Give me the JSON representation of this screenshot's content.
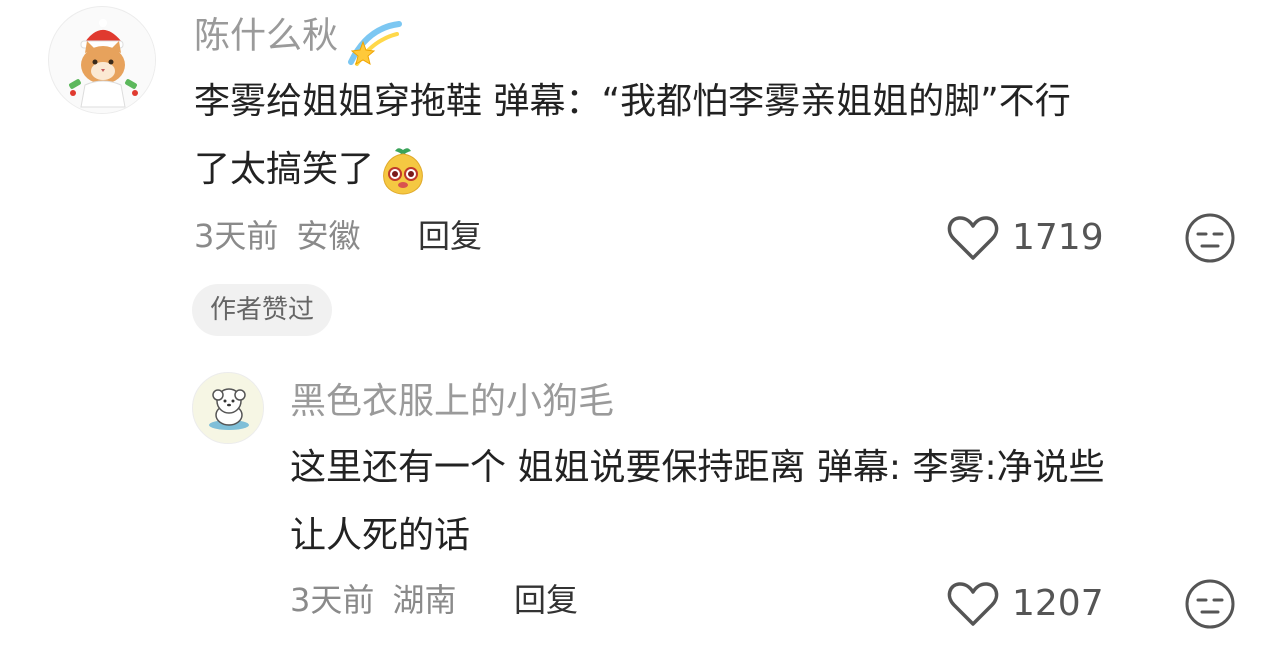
{
  "comments": [
    {
      "username": "陈什么秋",
      "text_line1": "李雾给姐姐穿拖鞋 弹幕：“我都怕李雾亲姐姐的脚”不行",
      "text_line2": "了太搞笑了",
      "time": "3天前",
      "location": "安徽",
      "reply_label": "回复",
      "likes": "1719",
      "author_badge": "作者赞过",
      "name_emoji": "sparkle-star-icon",
      "text_emoji": "pear-face-sticker-icon"
    },
    {
      "username": "黑色衣服上的小狗毛",
      "text_line1": "这里还有一个 姐姐说要保持距离 弹幕: 李雾:净说些",
      "text_line2": "让人死的话",
      "time": "3天前",
      "location": "湖南",
      "reply_label": "回复",
      "likes": "1207"
    }
  ],
  "colors": {
    "username": "#9a9a9a",
    "text": "#222222",
    "meta": "#8a8a8a",
    "badge_bg": "#f1f1f1"
  }
}
